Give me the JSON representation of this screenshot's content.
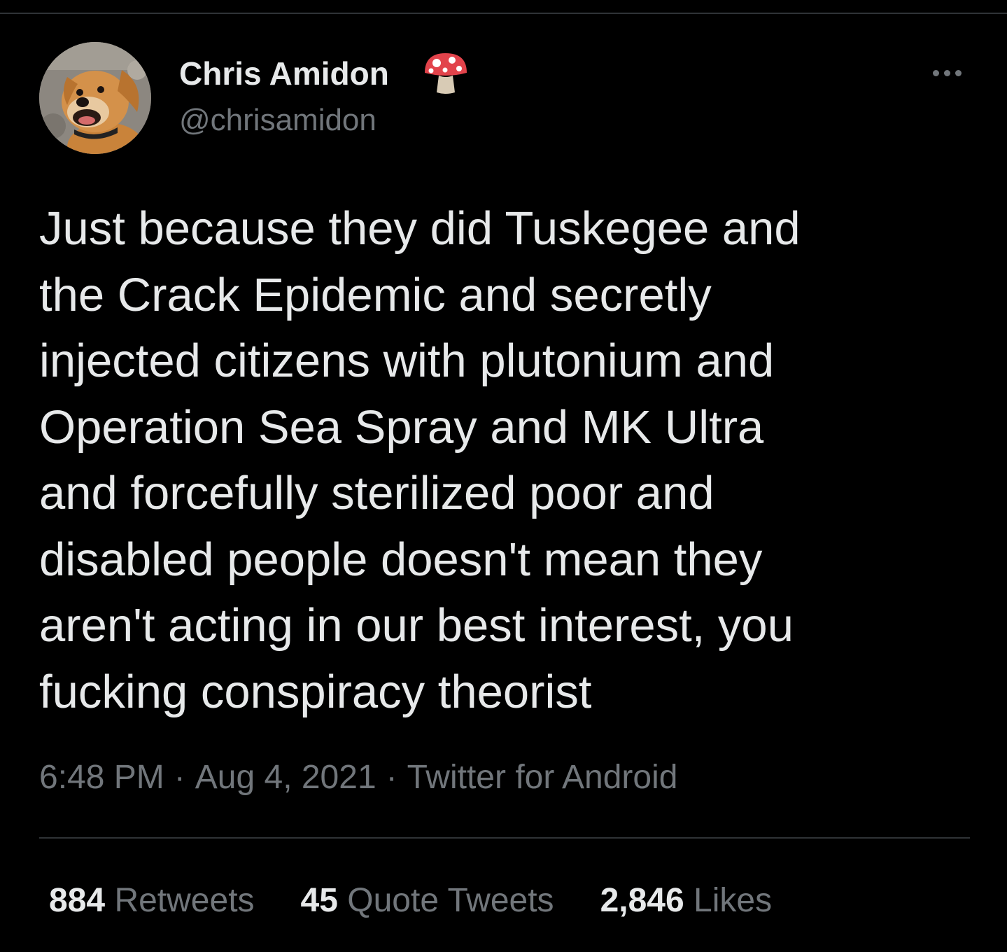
{
  "colors": {
    "background": "#000000",
    "primary_text": "#e7e9ea",
    "secondary_text": "#71767b",
    "divider": "#2f3336"
  },
  "author": {
    "display_name": "Chris Amidon",
    "badge_icon": "mushroom-icon",
    "handle": "@chrisamidon",
    "avatar_icon": "dog-avatar"
  },
  "more_icon": "more-dots-icon",
  "tweet": {
    "lines": [
      "Just because they did Tuskegee and",
      "the Crack Epidemic and secretly",
      "injected citizens with plutonium and",
      "Operation Sea Spray and MK Ultra",
      "and forcefully sterilized poor and",
      "disabled people doesn't mean they",
      "aren't acting in our best interest, you",
      "fucking conspiracy theorist"
    ]
  },
  "meta": {
    "time": "6:48 PM",
    "separator": "·",
    "date": "Aug 4, 2021",
    "source": "Twitter for Android"
  },
  "stats": {
    "retweets": {
      "count": "884",
      "label": "Retweets"
    },
    "quotes": {
      "count": "45",
      "label": "Quote Tweets"
    },
    "likes": {
      "count": "2,846",
      "label": "Likes"
    }
  }
}
